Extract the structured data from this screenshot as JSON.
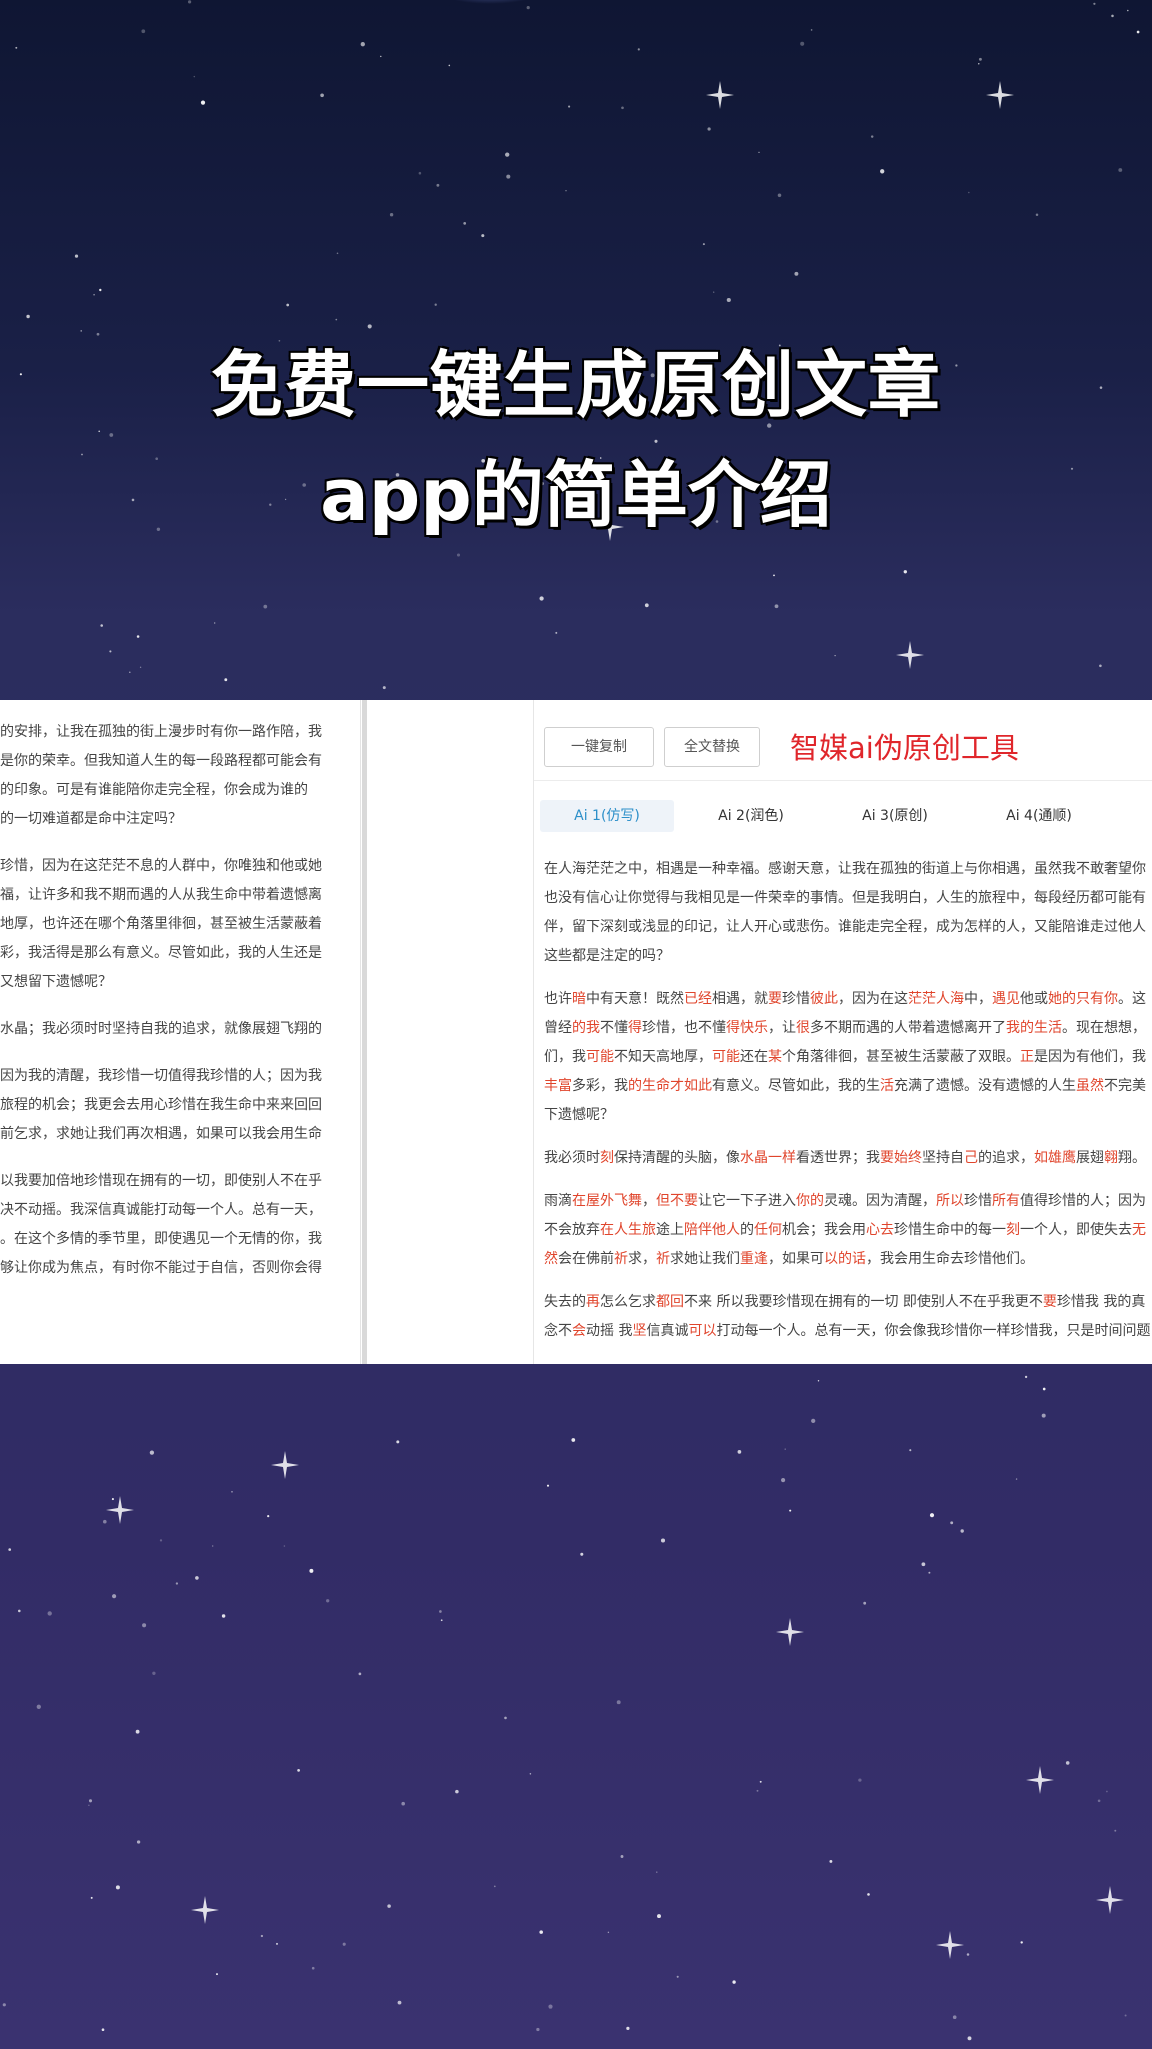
{
  "headline": {
    "line1": "免费一键生成原创文章",
    "line2": "app的简单介绍"
  },
  "left_document": {
    "paragraphs": [
      [
        "的安排，让我在孤独的街上漫步时有你一路作陪，我",
        "是你的荣幸。但我知道人生的每一段路程都可能会有",
        "的印象。可是有谁能陪你走完全程，你会成为谁的",
        "的一切难道都是命中注定吗？"
      ],
      [
        "珍惜，因为在这茫茫不息的人群中，你唯独和他或她",
        "福，让许多和我不期而遇的人从我生命中带着遗憾离",
        "地厚，也许还在哪个角落里徘徊，甚至被生活蒙蔽着",
        "彩，我活得是那么有意义。尽管如此，我的人生还是",
        "又想留下遗憾呢？"
      ],
      [
        "水晶；我必须时时坚持自我的追求，就像展翅飞翔的"
      ],
      [
        "因为我的清醒，我珍惜一切值得我珍惜的人；因为我",
        "旅程的机会；我更会去用心珍惜在我生命中来来回回",
        "前乞求，求她让我们再次相遇，如果可以我会用生命"
      ],
      [
        "以我要加倍地珍惜现在拥有的一切，即使别人不在乎",
        "决不动摇。我深信真诚能打动每一个人。总有一天，",
        "。在这个多情的季节里，即使遇见一个无情的你，我",
        "够让你成为焦点，有时你不能过于自信，否则你会得"
      ]
    ]
  },
  "toolbar": {
    "copy_label": "一键复制",
    "replace_label": "全文替换",
    "title": "智媒ai伪原创工具"
  },
  "tabs": [
    {
      "label": "Ai 1(仿写)",
      "active": true
    },
    {
      "label": "Ai 2(润色)",
      "active": false
    },
    {
      "label": "Ai 3(原创)",
      "active": false
    },
    {
      "label": "Ai 4(通顺)",
      "active": false
    }
  ],
  "article": {
    "paragraphs": [
      [
        [
          [
            "在人海茫茫之中，相遇是一种幸福。感谢天意，让我在孤独的街道上与你相遇，虽然我不敢奢望你",
            false
          ]
        ],
        [
          [
            "也没有信心让你觉得与我相见是一件荣幸的事情。但是我明白，人生的旅程中，每段经历都可能有",
            false
          ]
        ],
        [
          [
            "伴，留下深刻或浅显的印记，让人开心或悲伤。谁能走完全程，成为怎样的人，又能陪谁走过他人",
            false
          ]
        ],
        [
          [
            "这些都是注定的吗？",
            false
          ]
        ]
      ],
      [
        [
          [
            "也许",
            false
          ],
          [
            "暗",
            true
          ],
          [
            "中有天意！既然",
            false
          ],
          [
            "已经",
            true
          ],
          [
            "相遇，就",
            false
          ],
          [
            "要",
            true
          ],
          [
            "珍惜",
            false
          ],
          [
            "彼此",
            true
          ],
          [
            "，因为在这",
            false
          ],
          [
            "茫茫人海",
            true
          ],
          [
            "中，",
            false
          ],
          [
            "遇见",
            true
          ],
          [
            "他或",
            false
          ],
          [
            "她的只有你",
            true
          ],
          [
            "。这",
            false
          ]
        ],
        [
          [
            "曾经",
            false
          ],
          [
            "的我",
            true
          ],
          [
            "不懂",
            false
          ],
          [
            "得",
            true
          ],
          [
            "珍惜，也不懂",
            false
          ],
          [
            "得快乐",
            true
          ],
          [
            "，让",
            false
          ],
          [
            "很",
            true
          ],
          [
            "多不期而遇的人带着遗憾离开了",
            false
          ],
          [
            "我的生活",
            true
          ],
          [
            "。现在想想，",
            false
          ]
        ],
        [
          [
            "们，我",
            false
          ],
          [
            "可能",
            true
          ],
          [
            "不知天高地厚，",
            false
          ],
          [
            "可能",
            true
          ],
          [
            "还在",
            false
          ],
          [
            "某",
            true
          ],
          [
            "个角落徘徊，甚至被生活蒙蔽了双眼。",
            false
          ],
          [
            "正",
            true
          ],
          [
            "是因为有他们，我",
            false
          ]
        ],
        [
          [
            "丰富",
            true
          ],
          [
            "多彩，我",
            false
          ],
          [
            "的生命才如此",
            true
          ],
          [
            "有意义。尽管如此，我的生",
            false
          ],
          [
            "活",
            true
          ],
          [
            "充满了遗憾。没有遗憾的人生",
            false
          ],
          [
            "虽然",
            true
          ],
          [
            "不完美",
            false
          ]
        ],
        [
          [
            "下遗憾呢？",
            false
          ]
        ]
      ],
      [
        [
          [
            "我必须时",
            false
          ],
          [
            "刻",
            true
          ],
          [
            "保持清醒的头脑，像",
            false
          ],
          [
            "水晶一样",
            true
          ],
          [
            "看透世界；我",
            false
          ],
          [
            "要始终",
            true
          ],
          [
            "坚持自",
            false
          ],
          [
            "己",
            true
          ],
          [
            "的追求，",
            false
          ],
          [
            "如雄鹰",
            true
          ],
          [
            "展翅",
            false
          ],
          [
            "翱",
            true
          ],
          [
            "翔。",
            false
          ]
        ]
      ],
      [
        [
          [
            "雨滴",
            false
          ],
          [
            "在屋外飞舞",
            true
          ],
          [
            "，",
            false
          ],
          [
            "但不要",
            true
          ],
          [
            "让它一下子进入",
            false
          ],
          [
            "你的",
            true
          ],
          [
            "灵魂。因为清醒，",
            false
          ],
          [
            "所以",
            true
          ],
          [
            "珍惜",
            false
          ],
          [
            "所有",
            true
          ],
          [
            "值得珍惜的人；因为",
            false
          ]
        ],
        [
          [
            "不会放弃",
            false
          ],
          [
            "在人生旅",
            true
          ],
          [
            "途上",
            false
          ],
          [
            "陪伴他人",
            true
          ],
          [
            "的",
            false
          ],
          [
            "任何",
            true
          ],
          [
            "机会；我会用",
            false
          ],
          [
            "心去",
            true
          ],
          [
            "珍惜生命中的每一",
            false
          ],
          [
            "刻",
            true
          ],
          [
            "一个人，即使失去",
            false
          ],
          [
            "无",
            true
          ]
        ],
        [
          [
            "然",
            true
          ],
          [
            "会在佛前",
            false
          ],
          [
            "祈",
            true
          ],
          [
            "求，",
            false
          ],
          [
            "祈",
            true
          ],
          [
            "求她让我们",
            false
          ],
          [
            "重逢",
            true
          ],
          [
            "，如果可",
            false
          ],
          [
            "以的话",
            true
          ],
          [
            "，我会用生命去珍惜他们。",
            false
          ]
        ]
      ],
      [
        [
          [
            "失去的",
            false
          ],
          [
            "再",
            true
          ],
          [
            "怎么乞求",
            false
          ],
          [
            "都回",
            true
          ],
          [
            "不来 所以我要珍惜现在拥有的一切 即使别人不在乎我更不",
            false
          ],
          [
            "要",
            true
          ],
          [
            "珍惜我 我的真",
            false
          ]
        ],
        [
          [
            "念不",
            false
          ],
          [
            "会",
            true
          ],
          [
            "动摇 我",
            false
          ],
          [
            "坚",
            true
          ],
          [
            "信真诚",
            false
          ],
          [
            "可以",
            true
          ],
          [
            "打动每一个人。总有一天，你会像我珍惜你一样珍惜我，只是时间问题",
            false
          ]
        ]
      ]
    ]
  },
  "colors": {
    "accent_red": "#e0262b",
    "highlight_orange": "#e0452c",
    "tab_active_text": "#2c8fc9",
    "sky_top": "#0f1633",
    "sky_bottom": "#3a3270"
  }
}
